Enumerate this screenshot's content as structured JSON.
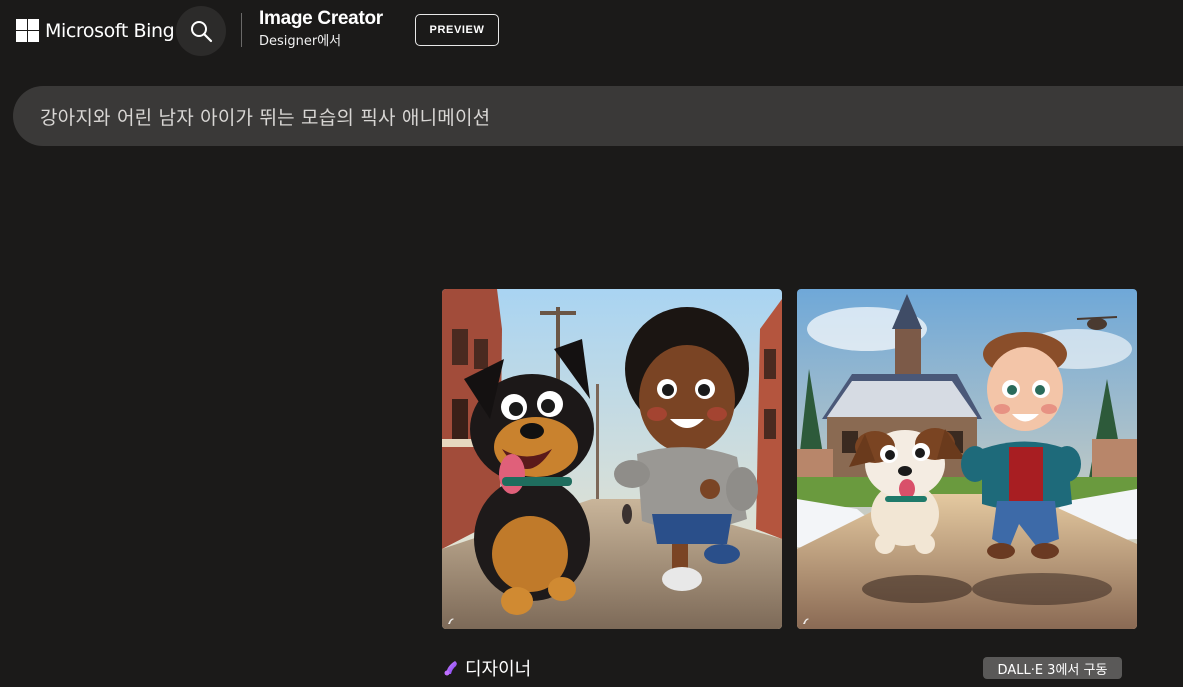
{
  "header": {
    "brand_name": "Microsoft Bing",
    "app_title": "Image Creator",
    "app_subtitle": "Designer에서",
    "preview_label": "PREVIEW"
  },
  "prompt": {
    "text": "강아지와 어린 남자 아이가 뛰는 모습의 픽사 애니메이션"
  },
  "results": {
    "images": [
      {
        "description": "Pixar-style black and tan puppy running with a curly-haired boy in a brick street"
      },
      {
        "description": "Pixar-style spotted puppy running with a boy in a red shirt in front of a snowy house"
      }
    ],
    "designer_label": "디자이너",
    "engine_badge": "DALL·E 3에서 구동"
  },
  "colors": {
    "background": "#1b1a19",
    "prompt_bg": "#3a3938",
    "badge_bg": "#5a5958"
  }
}
